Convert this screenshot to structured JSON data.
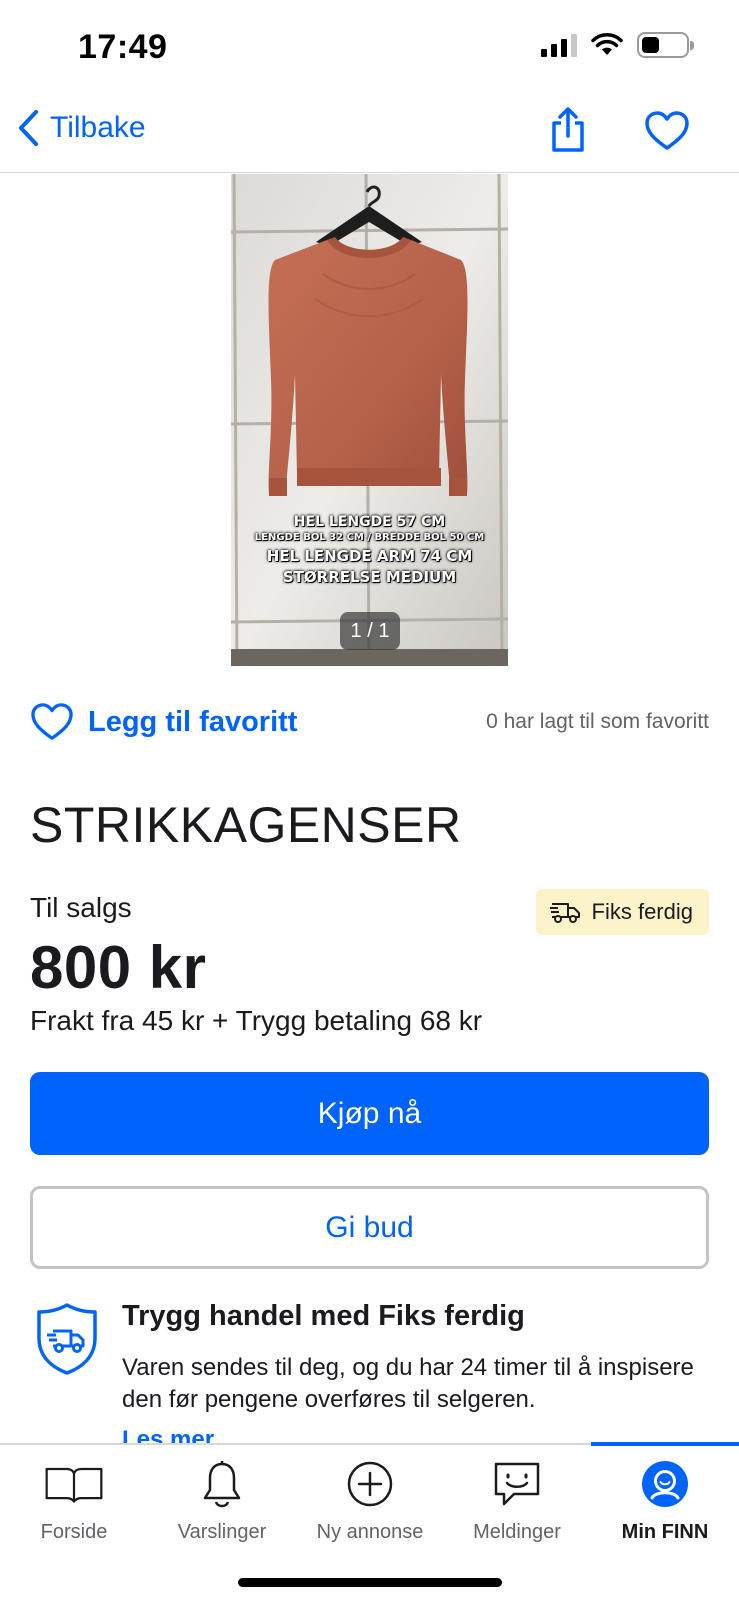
{
  "status_bar": {
    "time": "17:49"
  },
  "nav": {
    "back_label": "Tilbake"
  },
  "image": {
    "overlay_lines": [
      "HEL LENGDE 57 CM",
      "LENGDE BOL 32 CM / BREDDE BOL 50 CM",
      "HEL LENGDE ARM 74 CM",
      "STØRRELSE MEDIUM"
    ],
    "counter": "1 / 1"
  },
  "favorite": {
    "label": "Legg til favoritt",
    "count_text": "0 har lagt til som favoritt"
  },
  "listing": {
    "title": "STRIKKAGENSER",
    "sale_label": "Til salgs",
    "badge": "Fiks ferdig",
    "price": "800 kr",
    "shipping": "Frakt fra 45 kr + Trygg betaling 68 kr"
  },
  "actions": {
    "buy": "Kjøp nå",
    "bid": "Gi bud"
  },
  "safe_trade": {
    "title": "Trygg handel med Fiks ferdig",
    "description": "Varen sendes til deg, og du har 24 timer til å inspisere den før pengene overføres til selgeren.",
    "link": "Les mer"
  },
  "tabs": [
    {
      "label": "Forside",
      "icon": "book-icon"
    },
    {
      "label": "Varslinger",
      "icon": "bell-icon"
    },
    {
      "label": "Ny annonse",
      "icon": "plus-circle-icon"
    },
    {
      "label": "Meldinger",
      "icon": "chat-icon"
    },
    {
      "label": "Min FINN",
      "icon": "profile-icon",
      "active": true
    }
  ],
  "colors": {
    "accent": "#0063fb",
    "badge_bg": "#fdf3c8",
    "sweater": "#b8634a"
  }
}
